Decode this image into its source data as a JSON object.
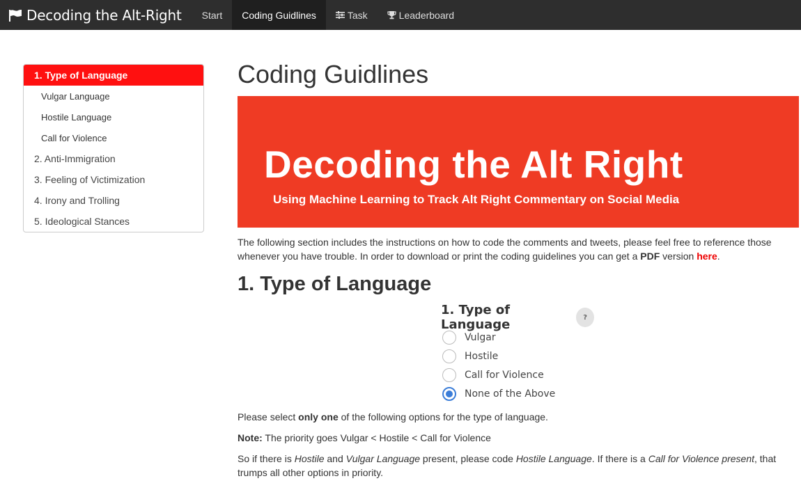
{
  "navbar": {
    "brand": "Decoding the Alt-Right",
    "items": [
      {
        "label": "Start"
      },
      {
        "label": "Coding Guidlines"
      },
      {
        "label": "Task"
      },
      {
        "label": "Leaderboard"
      }
    ]
  },
  "sidebar": {
    "items": [
      {
        "label": "1. Type of Language"
      },
      {
        "label": "Vulgar Language"
      },
      {
        "label": "Hostile Language"
      },
      {
        "label": "Call for Violence"
      },
      {
        "label": "2. Anti-Immigration"
      },
      {
        "label": "3. Feeling of Victimization"
      },
      {
        "label": "4. Irony and Trolling"
      },
      {
        "label": "5. Ideological Stances"
      }
    ]
  },
  "main": {
    "title": "Coding Guidlines",
    "banner_title": "Decoding the Alt Right",
    "banner_subtitle": "Using Machine Learning to Track Alt Right Commentary on Social Media",
    "intro_1": "The following section includes the instructions on how to code the comments and tweets, please feel free to reference those whenever you have trouble. In order to download or print the coding guidelines you can get a ",
    "intro_pdf": "PDF",
    "intro_2": " version ",
    "intro_link": "here",
    "intro_end": ".",
    "section_title": "1. Type of Language"
  },
  "form": {
    "title": "1. Type of Language",
    "help": "?",
    "options": [
      {
        "label": "Vulgar"
      },
      {
        "label": "Hostile"
      },
      {
        "label": "Call for Violence"
      },
      {
        "label": "None of the Above"
      }
    ]
  },
  "instructions": {
    "p1_a": "Please select ",
    "p1_b": "only one",
    "p1_c": " of the following options for the type of language.",
    "note_label": "Note:",
    "note_text": " The priority goes Vulgar < Hostile < Call for Violence",
    "p3_a": "So if there is ",
    "p3_b": "Hostile",
    "p3_c": " and ",
    "p3_d": "Vulgar Language",
    "p3_e": " present, please code ",
    "p3_f": "Hostile Language",
    "p3_g": ". If there is a ",
    "p3_h": "Call for Violence present",
    "p3_i": ", that trumps all other options in priority."
  },
  "colors": {
    "navbar": "#2e2e2e",
    "sidebar_active": "#ff1010",
    "banner": "#ef3b24",
    "link": "#ee0000",
    "radio_checked": "#3b7dd8"
  }
}
